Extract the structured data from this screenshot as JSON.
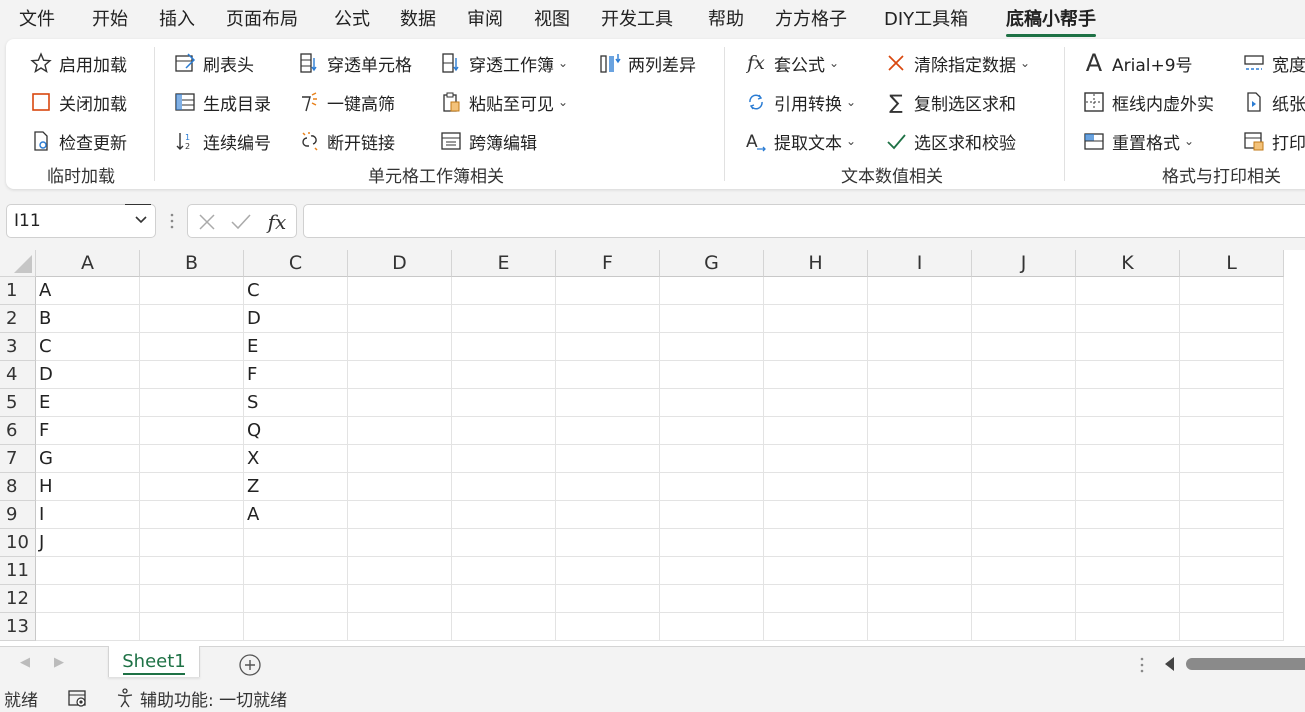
{
  "menu": [
    {
      "label": "文件"
    },
    {
      "label": "开始"
    },
    {
      "label": "插入"
    },
    {
      "label": "页面布局"
    },
    {
      "label": "公式"
    },
    {
      "label": "数据"
    },
    {
      "label": "审阅"
    },
    {
      "label": "视图"
    },
    {
      "label": "开发工具"
    },
    {
      "label": "帮助"
    },
    {
      "label": "方方格子"
    },
    {
      "label": "DIY工具箱"
    },
    {
      "label": "底稿小帮手",
      "active": true
    }
  ],
  "ribbon": {
    "groups": {
      "addin": "临时加载",
      "cell_workbook": "单元格工作簿相关",
      "text_number": "文本数值相关",
      "format_print": "格式与打印相关"
    },
    "buttons": {
      "enable_addin": "启用加载",
      "close_addin": "关闭加载",
      "check_update": "检查更新",
      "brush_header": "刷表头",
      "generate_toc": "生成目录",
      "sequential_number": "连续编号",
      "pierce_cell": "穿透单元格",
      "one_key_highlight": "一键高筛",
      "break_links": "断开链接",
      "pierce_workbook": "穿透工作簿",
      "paste_visible": "粘贴至可见",
      "cross_book_edit": "跨簿编辑",
      "two_col_diff": "两列差异",
      "apply_formula": "套公式",
      "ref_convert": "引用转换",
      "extract_text": "提取文本",
      "clear_data": "清除指定数据",
      "copy_sum": "复制选区求和",
      "sum_check": "选区求和校验",
      "font_preset": "Arial+9号",
      "dashed_border": "框线内虚外实",
      "reset_format": "重置格式",
      "width_partial": "宽度",
      "paper_partial": "纸张",
      "print_partial": "打印"
    }
  },
  "formula_bar": {
    "name_box": "I11",
    "formula": ""
  },
  "grid": {
    "columns": [
      "A",
      "B",
      "C",
      "D",
      "E",
      "F",
      "G",
      "H",
      "I",
      "J",
      "K",
      "L"
    ],
    "rows": [
      "1",
      "2",
      "3",
      "4",
      "5",
      "6",
      "7",
      "8",
      "9",
      "10",
      "11",
      "12",
      "13"
    ],
    "col_a": [
      "A",
      "B",
      "C",
      "D",
      "E",
      "F",
      "G",
      "H",
      "I",
      "J",
      "",
      "",
      ""
    ],
    "col_c": [
      "C",
      "D",
      "E",
      "F",
      "S",
      "Q",
      "X",
      "Z",
      "A",
      "",
      "",
      "",
      ""
    ]
  },
  "sheets": [
    {
      "label": "Sheet1",
      "active": true
    }
  ],
  "status": {
    "ready": "就绪",
    "accessibility": "辅助功能: 一切就绪"
  },
  "colors": {
    "accent": "#1e7145",
    "background": "#f3f3f3"
  }
}
